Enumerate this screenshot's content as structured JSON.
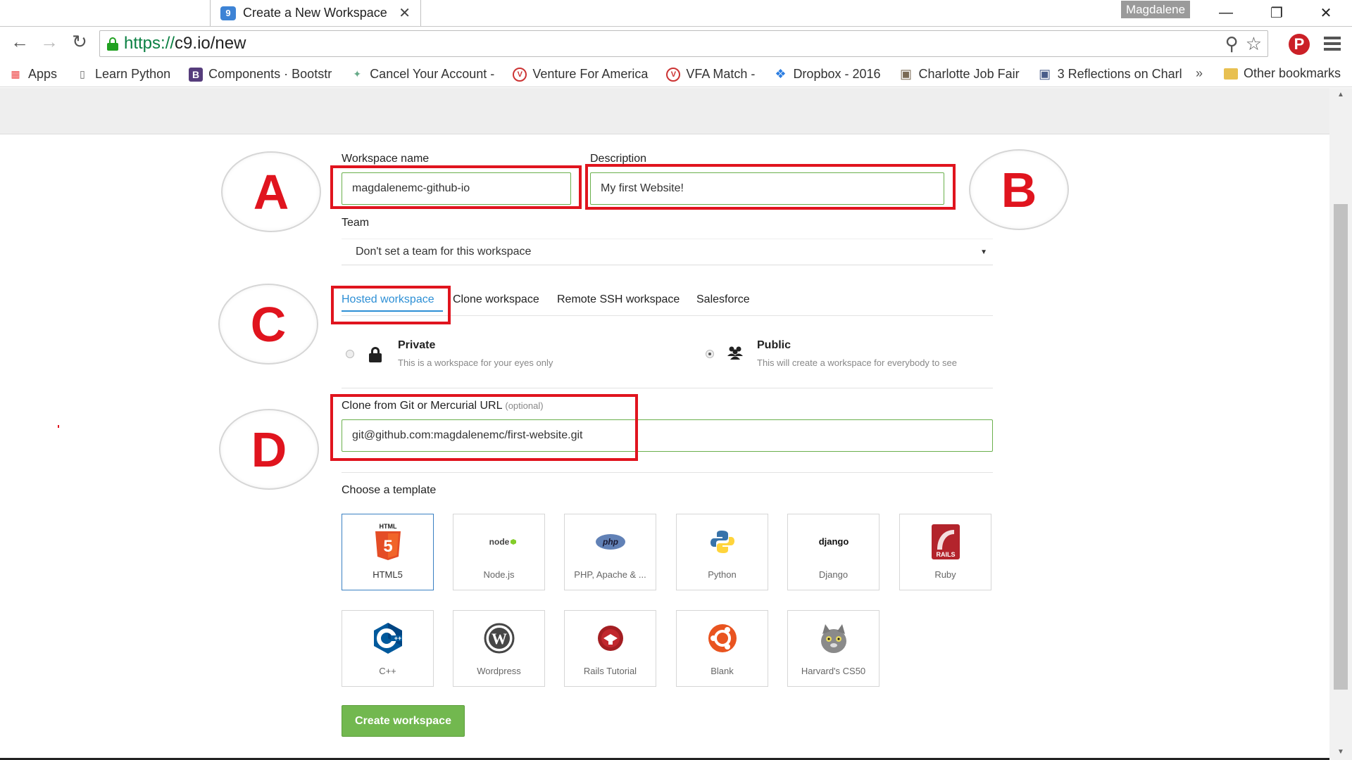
{
  "browser": {
    "tab_title": "Create a New Workspace",
    "tab_favicon": "9",
    "tab_close": "✕",
    "profile_name": "Magdalene",
    "window_minimize": "—",
    "window_restore": "❐",
    "window_close": "✕",
    "back": "←",
    "forward": "→",
    "reload": "↻",
    "url_scheme": "https://",
    "url_rest": "c9.io/new",
    "zoom_icon": "⚲",
    "star_icon": "☆",
    "pinterest": "P",
    "bookmarks": [
      {
        "icon": "apps-grid-icon",
        "glyph": "▦",
        "label": "Apps"
      },
      {
        "icon": "page-icon",
        "glyph": "▯",
        "label": "Learn Python"
      },
      {
        "icon": "bootstrap-icon",
        "glyph": "B",
        "label": "Components · Bootstr"
      },
      {
        "icon": "cancel-icon",
        "glyph": "✦",
        "label": "Cancel Your Account -"
      },
      {
        "icon": "vfa-icon",
        "glyph": "V",
        "label": "Venture For America"
      },
      {
        "icon": "vfa-match-icon",
        "glyph": "V",
        "label": "VFA Match -"
      },
      {
        "icon": "dropbox-icon",
        "glyph": "❖",
        "label": "Dropbox - 2016"
      },
      {
        "icon": "photo-icon",
        "glyph": "▣",
        "label": "Charlotte Job Fair"
      },
      {
        "icon": "flag-icon",
        "glyph": "▣",
        "label": "3 Reflections on Charl"
      }
    ],
    "bookmarks_more": "»",
    "other_bookmarks": "Other bookmarks"
  },
  "form": {
    "workspace_name_label": "Workspace name",
    "workspace_name_value": "magdalenemc-github-io",
    "description_label": "Description",
    "description_value": "My first Website!",
    "team_label": "Team",
    "team_value": "Don't set a team for this workspace",
    "team_caret": "▼",
    "tabs": [
      "Hosted workspace",
      "Clone workspace",
      "Remote SSH workspace",
      "Salesforce"
    ],
    "private_title": "Private",
    "private_sub": "This is a workspace for your eyes only",
    "public_title": "Public",
    "public_sub": "This will create a workspace for everybody to see",
    "visibility_selected": "Public",
    "clone_label": "Clone from Git or Mercurial URL",
    "clone_optional": "(optional)",
    "clone_value": "git@github.com:magdalenemc/first-website.git",
    "template_label": "Choose a template",
    "templates": [
      {
        "label": "HTML5",
        "icon": "html5-icon"
      },
      {
        "label": "Node.js",
        "icon": "nodejs-icon"
      },
      {
        "label": "PHP, Apache & ...",
        "icon": "php-icon"
      },
      {
        "label": "Python",
        "icon": "python-icon"
      },
      {
        "label": "Django",
        "icon": "django-icon"
      },
      {
        "label": "Ruby",
        "icon": "rails-icon"
      },
      {
        "label": "C++",
        "icon": "cpp-icon"
      },
      {
        "label": "Wordpress",
        "icon": "wordpress-icon"
      },
      {
        "label": "Rails Tutorial",
        "icon": "rails-tutorial-icon"
      },
      {
        "label": "Blank",
        "icon": "ubuntu-icon"
      },
      {
        "label": "Harvard's CS50",
        "icon": "cat-icon"
      }
    ],
    "selected_template": "HTML5",
    "create_button": "Create workspace"
  },
  "annotations": [
    "A",
    "B",
    "C",
    "D"
  ],
  "colors": {
    "annotation_red": "#e0141e",
    "accent_blue": "#2d8fd5",
    "create_green": "#72b84f",
    "input_border_green": "#6ab04c"
  }
}
